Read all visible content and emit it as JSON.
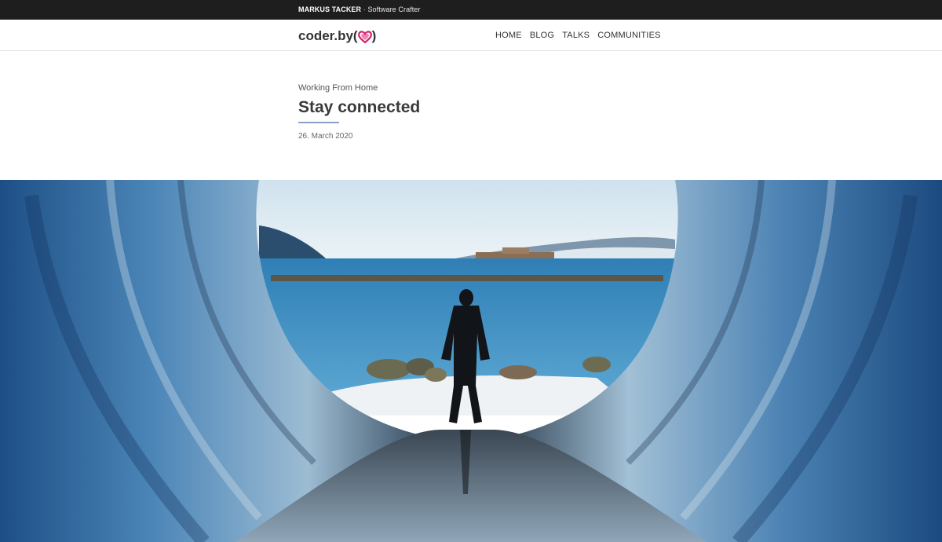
{
  "topbar": {
    "author_name": "MARKUS TACKER",
    "separator": " · ",
    "role": "Software Crafter"
  },
  "header": {
    "logo_text": "coder.by",
    "logo_paren_open": "(",
    "logo_paren_close": ")",
    "logo_icon": "heart-icon",
    "nav": [
      {
        "label": "HOME"
      },
      {
        "label": "BLOG"
      },
      {
        "label": "TALKS"
      },
      {
        "label": "COMMUNITIES"
      }
    ]
  },
  "post": {
    "category": "Working From Home",
    "title": "Stay connected",
    "date": "26. March 2020"
  },
  "colors": {
    "topbar_bg": "#1e1e1e",
    "heart": "#d6246e",
    "title_underline": "#8aa0c8"
  }
}
